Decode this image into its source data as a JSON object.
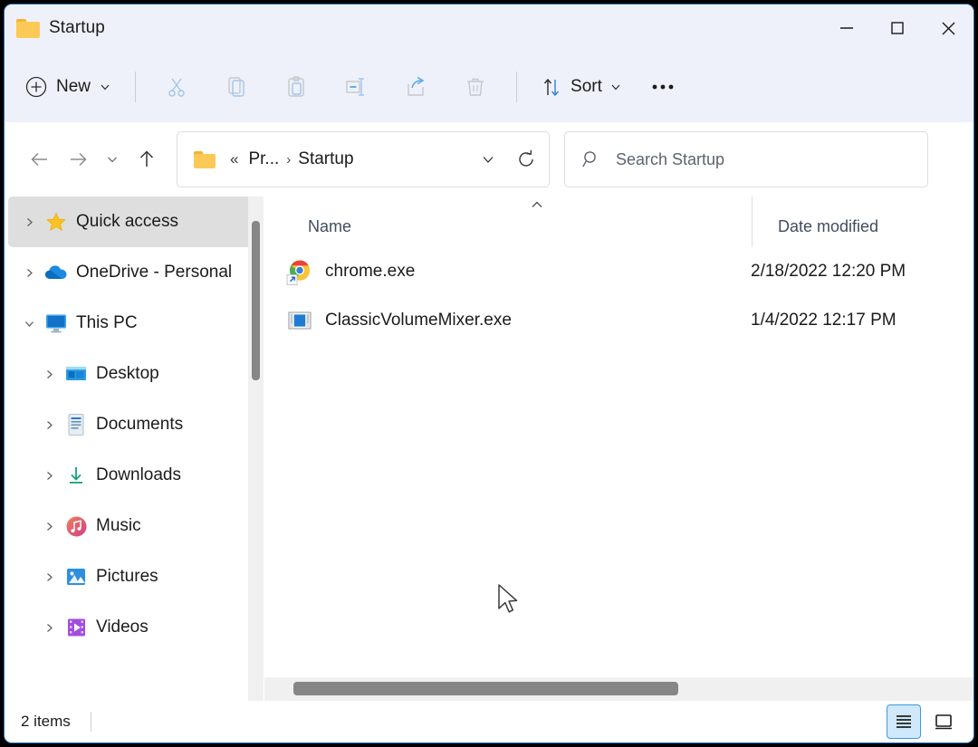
{
  "window": {
    "title": "Startup",
    "folder_icon": "folder-icon",
    "controls": {
      "minimize": "minimize-icon",
      "maximize": "maximize-icon",
      "close": "close-icon"
    }
  },
  "toolbar": {
    "new_label": "New",
    "new_icon": "plus-circle-icon",
    "new_chevron": "chevron-down-icon",
    "cut_icon": "scissors-icon",
    "copy_icon": "copy-icon",
    "paste_icon": "paste-icon",
    "rename_icon": "rename-icon",
    "share_icon": "share-icon",
    "delete_icon": "trash-icon",
    "sort_label": "Sort",
    "sort_icon": "sort-arrows-icon",
    "sort_chevron": "chevron-down-icon",
    "more_label": "•••",
    "more_icon": "ellipsis-icon"
  },
  "nav": {
    "back_icon": "arrow-left-icon",
    "forward_icon": "arrow-right-icon",
    "recent_icon": "chevron-down-icon",
    "up_icon": "arrow-up-icon"
  },
  "address": {
    "folder_icon": "folder-icon",
    "overflow": "«",
    "crumbs": [
      {
        "label": "Pr..."
      },
      {
        "label": "Startup"
      }
    ],
    "separator": "›",
    "dropdown_icon": "chevron-down-icon",
    "refresh_icon": "refresh-icon"
  },
  "search": {
    "icon": "search-icon",
    "placeholder": "Search Startup",
    "value": ""
  },
  "sidebar": {
    "items": [
      {
        "label": "Quick access",
        "icon": "star-icon",
        "expanded": false,
        "selected": true,
        "indent": false
      },
      {
        "label": "OneDrive - Personal",
        "icon": "onedrive-cloud-icon",
        "expanded": false,
        "selected": false,
        "indent": false
      },
      {
        "label": "This PC",
        "icon": "monitor-icon",
        "expanded": true,
        "selected": false,
        "indent": false
      },
      {
        "label": "Desktop",
        "icon": "desktop-icon",
        "expanded": false,
        "selected": false,
        "indent": true
      },
      {
        "label": "Documents",
        "icon": "documents-icon",
        "expanded": false,
        "selected": false,
        "indent": true
      },
      {
        "label": "Downloads",
        "icon": "downloads-icon",
        "expanded": false,
        "selected": false,
        "indent": true
      },
      {
        "label": "Music",
        "icon": "music-icon",
        "expanded": false,
        "selected": false,
        "indent": true
      },
      {
        "label": "Pictures",
        "icon": "pictures-icon",
        "expanded": false,
        "selected": false,
        "indent": true
      },
      {
        "label": "Videos",
        "icon": "videos-icon",
        "expanded": false,
        "selected": false,
        "indent": true
      }
    ]
  },
  "filelist": {
    "columns": [
      {
        "key": "name",
        "label": "Name",
        "sorted": true,
        "sort_direction": "ascending",
        "sort_glyph": "˄"
      },
      {
        "key": "date",
        "label": "Date modified",
        "sorted": false
      }
    ],
    "rows": [
      {
        "name": "chrome.exe",
        "date": "2/18/2022 12:20 PM",
        "icon": "chrome-shortcut-icon"
      },
      {
        "name": "ClassicVolumeMixer.exe",
        "date": "1/4/2022 12:17 PM",
        "icon": "classic-volume-mixer-icon"
      }
    ]
  },
  "status": {
    "item_count": "2 items",
    "view_details_icon": "details-view-icon",
    "view_pane_icon": "preview-pane-icon",
    "active_view": "details"
  },
  "colors": {
    "accent": "#2a6fc4",
    "toolbar_bg": "#eef1f9",
    "selection_bg": "#dedede",
    "icon_blue": "#1f7ad4",
    "folder_yellow": "#fcc956",
    "scrollbar_thumb": "#868686",
    "view_active_bg": "#cfe8fb"
  }
}
